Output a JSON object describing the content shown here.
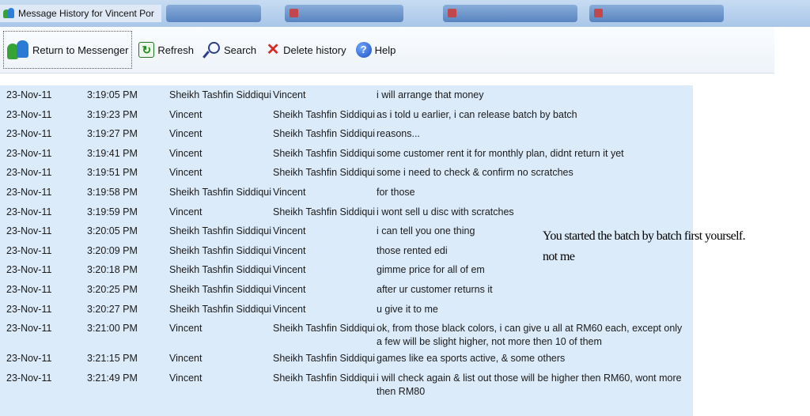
{
  "window": {
    "title": "Message History for Vincent Por",
    "icon": "messenger-buddies-icon"
  },
  "toolbar": {
    "return_label": "Return to Messenger",
    "refresh_label": "Refresh",
    "search_label": "Search",
    "delete_label": "Delete history",
    "help_label": "Help"
  },
  "history": {
    "rows": [
      {
        "date": "23-Nov-11",
        "time": "3:19:05 PM",
        "from": "Sheikh Tashfin Siddiqui",
        "to": "Vincent",
        "message": "i will arrange that money"
      },
      {
        "date": "23-Nov-11",
        "time": "3:19:23 PM",
        "from": "Vincent",
        "to": "Sheikh Tashfin Siddiqui",
        "message": "as i told u earlier, i can release batch by batch"
      },
      {
        "date": "23-Nov-11",
        "time": "3:19:27 PM",
        "from": "Vincent",
        "to": "Sheikh Tashfin Siddiqui",
        "message": "reasons..."
      },
      {
        "date": "23-Nov-11",
        "time": "3:19:41 PM",
        "from": "Vincent",
        "to": "Sheikh Tashfin Siddiqui",
        "message": "some customer rent it for monthly plan, didnt return it yet"
      },
      {
        "date": "23-Nov-11",
        "time": "3:19:51 PM",
        "from": "Vincent",
        "to": "Sheikh Tashfin Siddiqui",
        "message": "some i need to check & confirm no scratches"
      },
      {
        "date": "23-Nov-11",
        "time": "3:19:58 PM",
        "from": "Sheikh Tashfin Siddiqui",
        "to": "Vincent",
        "message": "for those"
      },
      {
        "date": "23-Nov-11",
        "time": "3:19:59 PM",
        "from": "Vincent",
        "to": "Sheikh Tashfin Siddiqui",
        "message": "i wont sell u disc with scratches"
      },
      {
        "date": "23-Nov-11",
        "time": "3:20:05 PM",
        "from": "Sheikh Tashfin Siddiqui",
        "to": "Vincent",
        "message": "i can tell you one thing"
      },
      {
        "date": "23-Nov-11",
        "time": "3:20:09 PM",
        "from": "Sheikh Tashfin Siddiqui",
        "to": "Vincent",
        "message": "those rented edi"
      },
      {
        "date": "23-Nov-11",
        "time": "3:20:18 PM",
        "from": "Sheikh Tashfin Siddiqui",
        "to": "Vincent",
        "message": "gimme price for all of em"
      },
      {
        "date": "23-Nov-11",
        "time": "3:20:25 PM",
        "from": "Sheikh Tashfin Siddiqui",
        "to": "Vincent",
        "message": "after ur customer returns it"
      },
      {
        "date": "23-Nov-11",
        "time": "3:20:27 PM",
        "from": "Sheikh Tashfin Siddiqui",
        "to": "Vincent",
        "message": "u give it to me"
      },
      {
        "date": "23-Nov-11",
        "time": "3:21:00 PM",
        "from": "Vincent",
        "to": "Sheikh Tashfin Siddiqui",
        "message": "ok, from those black colors, i can give u all at RM60 each, except only a few will be slight higher, not more then 10 of them"
      },
      {
        "date": "23-Nov-11",
        "time": "3:21:15 PM",
        "from": "Vincent",
        "to": "Sheikh Tashfin Siddiqui",
        "message": "games like ea sports active, & some others"
      },
      {
        "date": "23-Nov-11",
        "time": "3:21:49 PM",
        "from": "Vincent",
        "to": "Sheikh Tashfin Siddiqui",
        "message": "i will check again & list out those will be higher then RM60, wont more then RM80"
      }
    ]
  },
  "annotation": {
    "line1": "You started the batch by batch first yourself.",
    "line2": "not me"
  }
}
